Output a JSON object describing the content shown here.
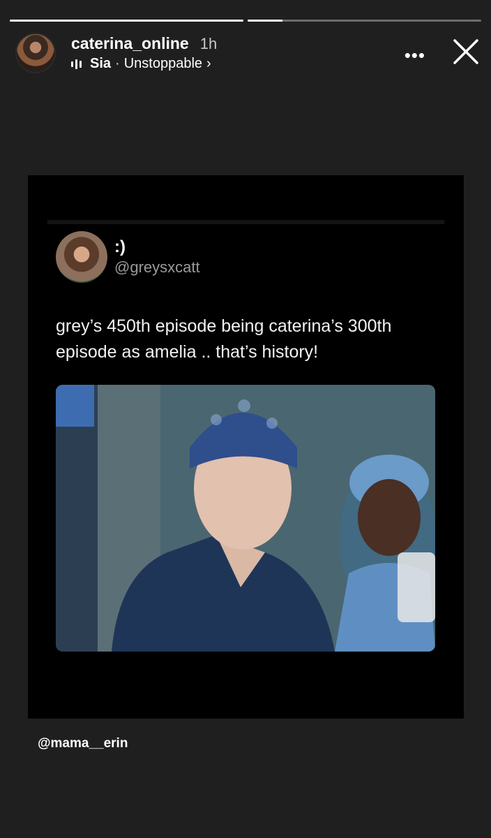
{
  "story": {
    "progress": [
      1.0,
      0.15
    ],
    "username": "caterina_online",
    "time": "1h",
    "music": {
      "artist": "Sia",
      "separator": "·",
      "song": "Unstoppable",
      "chevron": "›"
    },
    "more_label": "•••",
    "icons": {
      "music": "music-bars-icon",
      "close": "close-icon"
    }
  },
  "tweet": {
    "display_name": ":)",
    "handle": "@greysxcatt",
    "text": "grey’s 450th episode being caterina’s 300th episode as amelia .. that’s history!"
  },
  "mention": "@mama__erin"
}
